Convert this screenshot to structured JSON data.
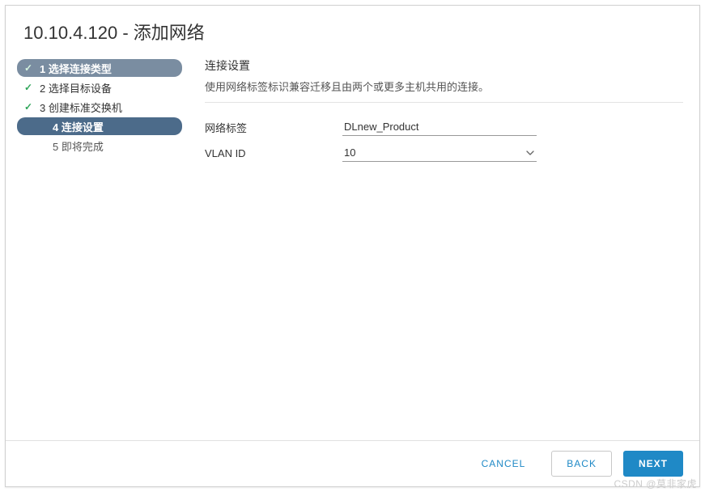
{
  "dialog": {
    "title": "10.10.4.120 - 添加网络"
  },
  "sidebar": {
    "steps": [
      {
        "label": "1 选择连接类型",
        "state": "completed-highlight"
      },
      {
        "label": "2 选择目标设备",
        "state": "completed"
      },
      {
        "label": "3 创建标准交换机",
        "state": "completed"
      },
      {
        "label": "4 连接设置",
        "state": "current"
      },
      {
        "label": "5 即将完成",
        "state": "pending"
      }
    ]
  },
  "main": {
    "heading": "连接设置",
    "description": "使用网络标签标识兼容迁移且由两个或更多主机共用的连接。",
    "fields": {
      "network_label": {
        "label": "网络标签",
        "value": "DLnew_Product"
      },
      "vlan_id": {
        "label": "VLAN ID",
        "value": "10"
      }
    }
  },
  "footer": {
    "cancel": "CANCEL",
    "back": "BACK",
    "next": "NEXT"
  },
  "watermark": "CSDN @莫非家虎"
}
